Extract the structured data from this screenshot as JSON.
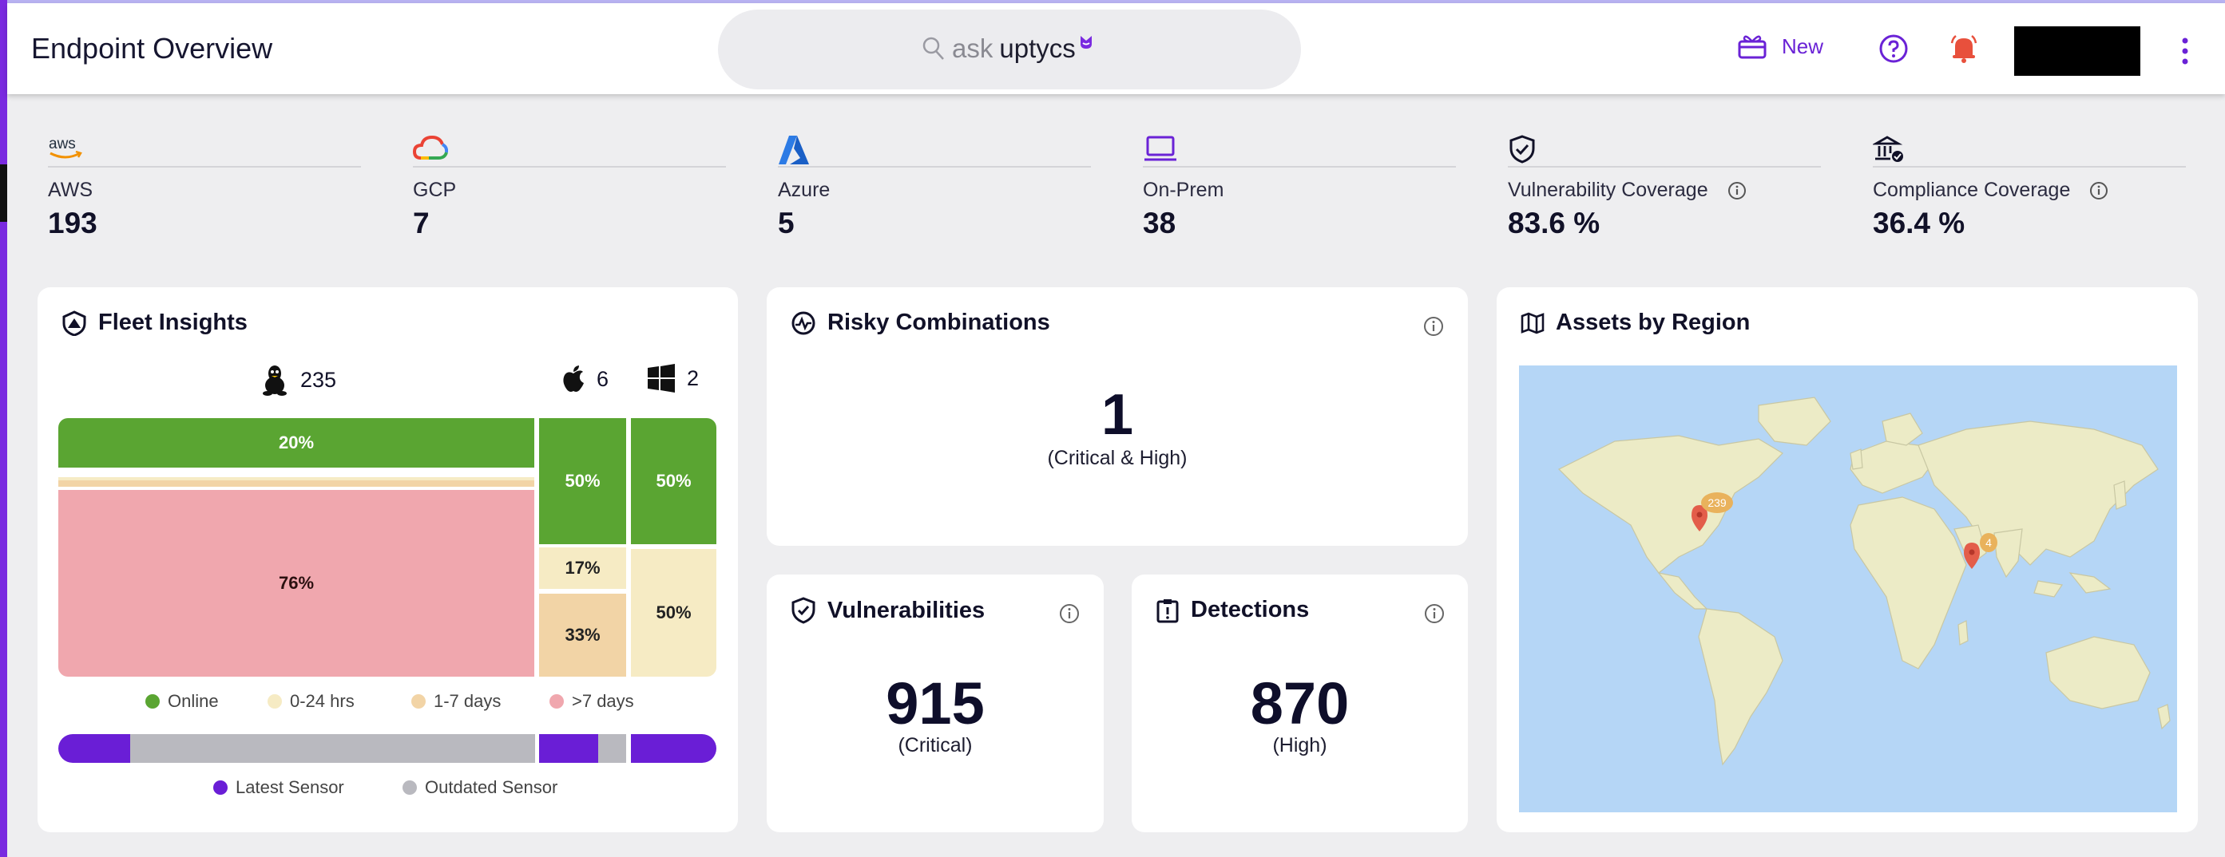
{
  "header": {
    "title": "Endpoint Overview",
    "search_ask": "ask",
    "search_brand": "uptycs",
    "new_label": "New"
  },
  "stats": [
    {
      "label": "AWS",
      "value": "193",
      "icon": "aws-logo-icon"
    },
    {
      "label": "GCP",
      "value": "7",
      "icon": "gcp-logo-icon"
    },
    {
      "label": "Azure",
      "value": "5",
      "icon": "azure-logo-icon"
    },
    {
      "label": "On-Prem",
      "value": "38",
      "icon": "laptop-icon"
    },
    {
      "label": "Vulnerability Coverage",
      "value": "83.6 %",
      "icon": "shield-check-icon"
    },
    {
      "label": "Compliance Coverage",
      "value": "36.4 %",
      "icon": "compliance-building-icon"
    }
  ],
  "fleet": {
    "title": "Fleet Insights",
    "linux_count": "235",
    "mac_count": "6",
    "windows_count": "2",
    "treemap": {
      "linux": {
        "online": "20%",
        "stale": "76%"
      },
      "mac": {
        "online": "50%",
        "recent": "17%",
        "days": "33%"
      },
      "windows": {
        "online": "50%",
        "recent": "50%"
      }
    },
    "legend": [
      "Online",
      "0-24 hrs",
      "1-7 days",
      ">7 days"
    ],
    "sensor_legend": [
      "Latest Sensor",
      "Outdated Sensor"
    ],
    "colors": {
      "online": "#5aa532",
      "hrs": "#f6ebc4",
      "days": "#f2d4a6",
      "stale": "#f0a7ae",
      "latest": "#6a1ed6",
      "outdated": "#b9b9bf"
    }
  },
  "risky": {
    "title": "Risky Combinations",
    "value": "1",
    "caption": "(Critical & High)"
  },
  "vulnerabilities": {
    "title": "Vulnerabilities",
    "value": "915",
    "caption": "(Critical)"
  },
  "detections": {
    "title": "Detections",
    "value": "870",
    "caption": "(High)"
  },
  "assets": {
    "title": "Assets by Region",
    "markers": [
      {
        "region": "North America",
        "count": "239"
      },
      {
        "region": "India",
        "count": "4"
      }
    ]
  }
}
